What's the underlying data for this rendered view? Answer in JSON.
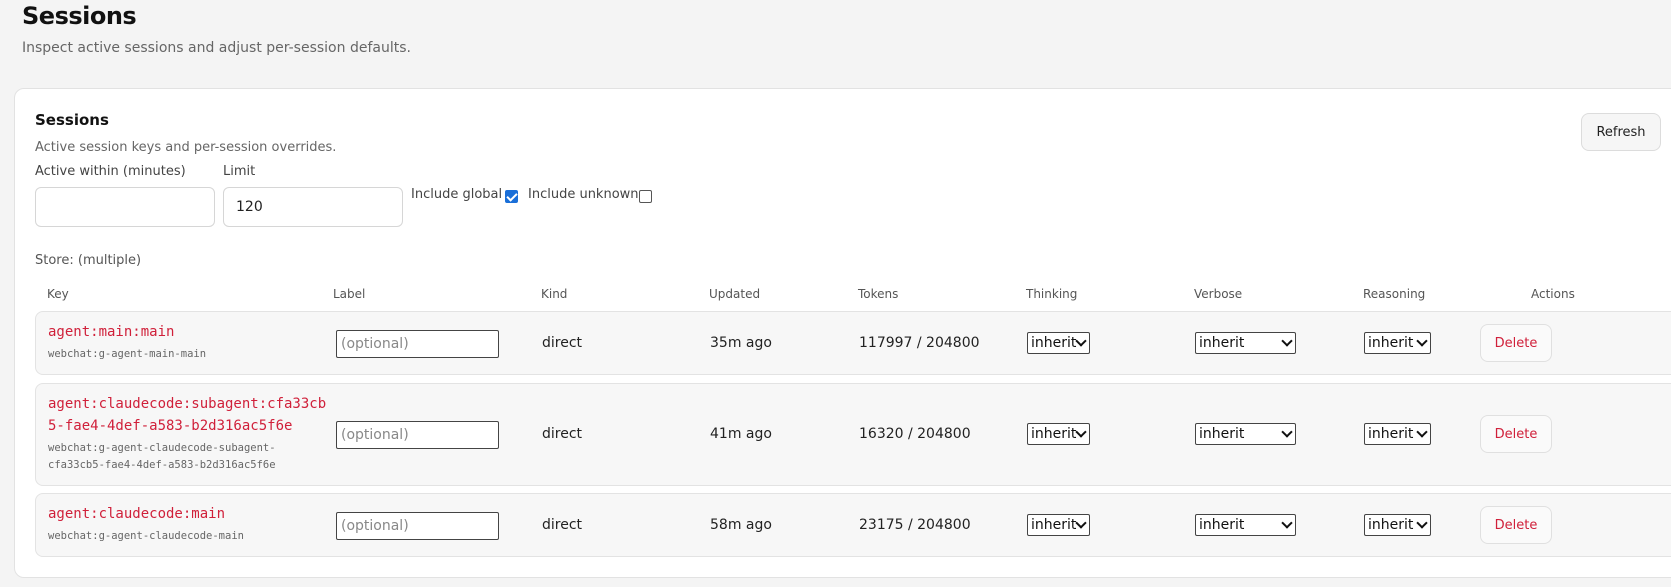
{
  "page": {
    "title": "Sessions",
    "subtitle": "Inspect active sessions and adjust per-session defaults."
  },
  "card": {
    "title": "Sessions",
    "subtitle": "Active session keys and per-session overrides.",
    "refresh_label": "Refresh"
  },
  "filters": {
    "active_within_label": "Active within (minutes)",
    "active_within_value": "",
    "limit_label": "Limit",
    "limit_value": "120",
    "include_global_label": "Include global",
    "include_global_checked": true,
    "include_unknown_label": "Include unknown",
    "include_unknown_checked": false
  },
  "store_text": "Store: (multiple)",
  "table": {
    "columns": [
      "Key",
      "Label",
      "Kind",
      "Updated",
      "Tokens",
      "Thinking",
      "Verbose",
      "Reasoning",
      "Actions"
    ],
    "label_placeholder": "(optional)",
    "delete_label": "Delete",
    "rows": [
      {
        "key_lines": [
          "agent:main:main"
        ],
        "sub_lines": [
          "webchat:g-agent-main-main"
        ],
        "kind": "direct",
        "updated": "35m ago",
        "tokens": "117997 / 204800",
        "thinking": "inherit",
        "verbose": "inherit",
        "reasoning": "inherit"
      },
      {
        "key_lines": [
          "agent:claudecode:subagent:cfa33cb",
          "5-fae4-4def-a583-b2d316ac5f6e"
        ],
        "sub_lines": [
          "webchat:g-agent-claudecode-subagent-",
          "cfa33cb5-fae4-4def-a583-b2d316ac5f6e"
        ],
        "kind": "direct",
        "updated": "41m ago",
        "tokens": "16320 / 204800",
        "thinking": "inherit",
        "verbose": "inherit",
        "reasoning": "inherit"
      },
      {
        "key_lines": [
          "agent:claudecode:main"
        ],
        "sub_lines": [
          "webchat:g-agent-claudecode-main"
        ],
        "kind": "direct",
        "updated": "58m ago",
        "tokens": "23175 / 204800",
        "thinking": "inherit",
        "verbose": "inherit",
        "reasoning": "inherit"
      }
    ]
  }
}
